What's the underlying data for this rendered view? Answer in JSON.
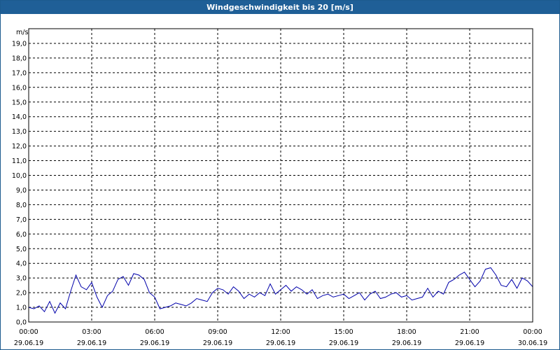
{
  "window": {
    "title": "Windgeschwindigkeit bis 20 [m/s]"
  },
  "chart_data": {
    "type": "line",
    "title": "Windgeschwindigkeit bis 20 [m/s]",
    "ylabel": "m/s",
    "xlabel": "",
    "ylim": [
      0,
      20
    ],
    "xlim_hours": [
      0,
      24
    ],
    "y_ticks": [
      "0,0",
      "1,0",
      "2,0",
      "3,0",
      "4,0",
      "5,0",
      "6,0",
      "7,0",
      "8,0",
      "9,0",
      "10,0",
      "11,0",
      "12,0",
      "13,0",
      "14,0",
      "15,0",
      "16,0",
      "17,0",
      "18,0",
      "19,0"
    ],
    "x_ticks": [
      {
        "time": "00:00",
        "date": "29.06.19"
      },
      {
        "time": "03:00",
        "date": "29.06.19"
      },
      {
        "time": "06:00",
        "date": "29.06.19"
      },
      {
        "time": "09:00",
        "date": "29.06.19"
      },
      {
        "time": "12:00",
        "date": "29.06.19"
      },
      {
        "time": "15:00",
        "date": "29.06.19"
      },
      {
        "time": "18:00",
        "date": "29.06.19"
      },
      {
        "time": "21:00",
        "date": "29.06.19"
      },
      {
        "time": "00:00",
        "date": "30.06.19"
      }
    ],
    "grid": true,
    "line_color": "#0000aa",
    "series": [
      {
        "x": [
          0,
          0.25,
          0.5,
          0.75,
          1.0,
          1.25,
          1.5,
          1.75,
          2.0,
          2.25,
          2.5,
          2.75,
          3.0,
          3.25,
          3.5,
          3.75,
          4.0,
          4.25,
          4.5,
          4.75,
          5.0,
          5.25,
          5.5,
          5.75,
          6.0,
          6.25,
          6.5,
          6.75,
          7.0,
          7.25,
          7.5,
          7.75,
          8.0,
          8.25,
          8.5,
          8.75,
          9.0,
          9.25,
          9.5,
          9.75,
          10.0,
          10.25,
          10.5,
          10.75,
          11.0,
          11.25,
          11.5,
          11.75,
          12.0,
          12.25,
          12.5,
          12.75,
          13.0,
          13.25,
          13.5,
          13.75,
          14.0,
          14.25,
          14.5,
          14.75,
          15.0,
          15.25,
          15.5,
          15.75,
          16.0,
          16.25,
          16.5,
          16.75,
          17.0,
          17.25,
          17.5,
          17.75,
          18.0,
          18.25,
          18.5,
          18.75,
          19.0,
          19.25,
          19.5,
          19.75,
          20.0,
          20.25,
          20.5,
          20.75,
          21.0,
          21.25,
          21.5,
          21.75,
          22.0,
          22.25,
          22.5,
          22.75,
          23.0,
          23.25,
          23.5,
          23.75,
          24.0
        ],
        "values": [
          1.0,
          0.9,
          1.1,
          0.7,
          1.4,
          0.6,
          1.3,
          0.9,
          2.1,
          3.2,
          2.4,
          2.2,
          2.7,
          1.7,
          1.0,
          1.8,
          2.1,
          2.9,
          3.1,
          2.5,
          3.3,
          3.2,
          2.9,
          2.0,
          1.7,
          0.9,
          1.0,
          1.1,
          1.3,
          1.2,
          1.1,
          1.3,
          1.6,
          1.5,
          1.4,
          2.0,
          2.3,
          2.2,
          1.9,
          2.4,
          2.1,
          1.6,
          1.9,
          1.7,
          2.0,
          1.8,
          2.6,
          1.9,
          2.2,
          2.5,
          2.1,
          2.4,
          2.2,
          1.9,
          2.2,
          1.6,
          1.8,
          1.9,
          1.7,
          1.8,
          1.9,
          1.6,
          1.8,
          2.0,
          1.5,
          1.9,
          2.1,
          1.6,
          1.7,
          1.9,
          2.0,
          1.7,
          1.8,
          1.5,
          1.6,
          1.7,
          2.3,
          1.7,
          2.1,
          1.9,
          2.7,
          2.9,
          3.2,
          3.4,
          2.9,
          2.4,
          2.8,
          3.6,
          3.7,
          3.2,
          2.5,
          2.4,
          2.9,
          2.3,
          3.0,
          2.8,
          2.4
        ]
      }
    ]
  }
}
